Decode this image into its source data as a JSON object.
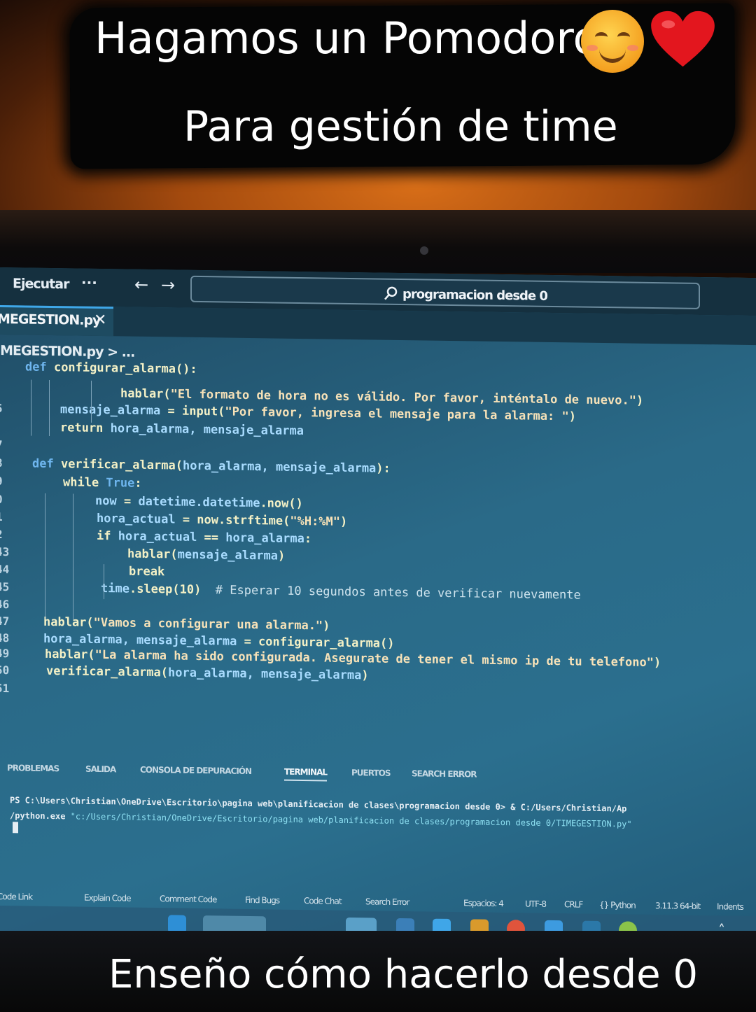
{
  "overlay": {
    "title_line1": "Hagamos un Pomodoro",
    "title_line2": "Para gestión de time",
    "bottom_caption": "Enseño cómo hacerlo desde 0",
    "emoji_icons": [
      "smiling-face-icon",
      "red-heart-icon"
    ]
  },
  "editor": {
    "menu_run": "Ejecutar",
    "menu_more": "···",
    "search": "programacion desde 0",
    "tab_label": "MEGESTION.py",
    "tab_close": "✕",
    "breadcrumb": "IMEGESTION.py > ...",
    "code_lines": [
      {
        "n": "",
        "parts": [
          [
            "kw",
            "def "
          ],
          [
            "fn",
            "configurar_alarma():"
          ]
        ]
      },
      {
        "n": "",
        "parts": [
          [
            "fn",
            "hablar("
          ],
          [
            "str",
            "\"El formato de hora no es válido. Por favor, inténtalo de nuevo.\""
          ],
          [
            "fn",
            ")"
          ]
        ]
      },
      {
        "n": "5",
        "parts": [
          [
            "var",
            "mensaje_alarma"
          ],
          [
            "fn",
            " = input("
          ],
          [
            "str",
            "\"Por favor, ingresa el mensaje para la alarma: \""
          ],
          [
            "fn",
            ")"
          ]
        ]
      },
      {
        "n": "",
        "parts": [
          [
            "fn",
            "return "
          ],
          [
            "var",
            "hora_alarma, mensaje_alarma"
          ]
        ]
      },
      {
        "n": "7",
        "parts": []
      },
      {
        "n": "8",
        "parts": [
          [
            "kw",
            "def "
          ],
          [
            "fn",
            "verificar_alarma("
          ],
          [
            "var",
            "hora_alarma, mensaje_alarma"
          ],
          [
            "fn",
            "):"
          ]
        ]
      },
      {
        "n": "9",
        "parts": [
          [
            "fn",
            "while "
          ],
          [
            "kw",
            "True"
          ],
          [
            "fn",
            ":"
          ]
        ]
      },
      {
        "n": "0",
        "parts": [
          [
            "var",
            "now"
          ],
          [
            "fn",
            " = "
          ],
          [
            "var",
            "datetime.datetime"
          ],
          [
            "fn",
            ".now()"
          ]
        ]
      },
      {
        "n": "1",
        "parts": [
          [
            "var",
            "hora_actual"
          ],
          [
            "fn",
            " = now.strftime("
          ],
          [
            "str",
            "\"%H:%M\""
          ],
          [
            "fn",
            ")"
          ]
        ]
      },
      {
        "n": "2",
        "parts": [
          [
            "fn",
            "if "
          ],
          [
            "var",
            "hora_actual"
          ],
          [
            "fn",
            " == "
          ],
          [
            "var",
            "hora_alarma"
          ],
          [
            "fn",
            ":"
          ]
        ]
      },
      {
        "n": "43",
        "parts": [
          [
            "fn",
            "hablar("
          ],
          [
            "var",
            "mensaje_alarma"
          ],
          [
            "fn",
            ")"
          ]
        ]
      },
      {
        "n": "44",
        "parts": [
          [
            "fn",
            "break"
          ]
        ]
      },
      {
        "n": "45",
        "parts": [
          [
            "var",
            "time"
          ],
          [
            "fn",
            ".sleep(10)  "
          ],
          [
            "cm",
            "# Esperar 10 segundos antes de verificar nuevamente"
          ]
        ]
      },
      {
        "n": "46",
        "parts": []
      },
      {
        "n": "47",
        "parts": [
          [
            "fn",
            "hablar("
          ],
          [
            "str",
            "\"Vamos a configurar una alarma.\""
          ],
          [
            "fn",
            ")"
          ]
        ]
      },
      {
        "n": "48",
        "parts": [
          [
            "var",
            "hora_alarma, mensaje_alarma"
          ],
          [
            "fn",
            " = configurar_alarma()"
          ]
        ]
      },
      {
        "n": "49",
        "parts": [
          [
            "fn",
            "hablar("
          ],
          [
            "str",
            "\"La alarma ha sido configurada. Asegurate de tener el mismo ip de tu telefono\""
          ],
          [
            "fn",
            ")"
          ]
        ]
      },
      {
        "n": "50",
        "parts": [
          [
            "fn",
            "verificar_alarma("
          ],
          [
            "var",
            "hora_alarma, mensaje_alarma"
          ],
          [
            "fn",
            ")"
          ]
        ]
      },
      {
        "n": "51",
        "parts": []
      }
    ],
    "panel_tabs": [
      "PROBLEMAS",
      "SALIDA",
      "CONSOLA DE DEPURACIÓN",
      "TERMINAL",
      "PUERTOS",
      "SEARCH ERROR"
    ],
    "active_panel_tab": "TERMINAL",
    "terminal_line1": "PS C:\\Users\\Christian\\OneDrive\\Escritorio\\pagina web\\planificacion de clases\\programacion desde 0> & C:/Users/Christian/Ap",
    "terminal_line2_cmd": "/python.exe ",
    "terminal_line2_arg": "\"c:/Users/Christian/OneDrive/Escritorio/pagina web/planificacion de clases/programacion desde 0/TIMEGESTION.py\"",
    "status_left": [
      "Code Link",
      "Explain Code",
      "Comment Code",
      "Find Bugs",
      "Code Chat",
      "Search Error"
    ],
    "status_right": [
      "Espacios: 4",
      "UTF-8",
      "CRLF",
      "{} Python",
      "3.11.3 64-bit",
      "Indents"
    ]
  }
}
